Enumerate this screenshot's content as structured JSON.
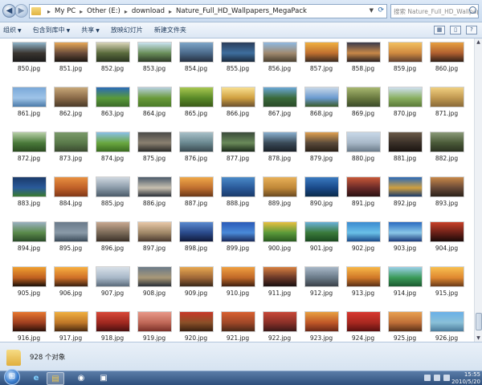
{
  "address_bar": {
    "crumbs": [
      "My PC",
      "Other (E:)",
      "download",
      "Nature_Full_HD_Wallpapers_MegaPack"
    ],
    "search_placeholder": "搜索 Nature_Full_HD_Wallpapers..."
  },
  "toolbar": {
    "organize": "组织",
    "include_in_library": "包含到库中",
    "share": "共享",
    "slideshow": "放映幻灯片",
    "new_folder": "新建文件夹"
  },
  "files": [
    {
      "name": "850.jpg",
      "colors": [
        "#8fb4c9",
        "#3a3530",
        "#1a1a1a"
      ]
    },
    {
      "name": "851.jpg",
      "colors": [
        "#e8a858",
        "#6a4c3a",
        "#1b1712"
      ]
    },
    {
      "name": "852.jpg",
      "colors": [
        "#d9d4b8",
        "#5a6b3c",
        "#2a3520"
      ]
    },
    {
      "name": "853.jpg",
      "colors": [
        "#c9e3f0",
        "#6a8f5a",
        "#2e3b28"
      ]
    },
    {
      "name": "854.jpg",
      "colors": [
        "#7ea6c9",
        "#4b6a8a",
        "#263040"
      ]
    },
    {
      "name": "855.jpg",
      "colors": [
        "#2a3d5a",
        "#3e6e9e",
        "#1a2a3c"
      ]
    },
    {
      "name": "856.jpg",
      "colors": [
        "#8fb8e0",
        "#a08a70",
        "#4a4030"
      ]
    },
    {
      "name": "857.jpg",
      "colors": [
        "#f0b040",
        "#c07030",
        "#3a2a20"
      ]
    },
    {
      "name": "858.jpg",
      "colors": [
        "#3a3a4a",
        "#c88848",
        "#2a2020"
      ]
    },
    {
      "name": "859.jpg",
      "colors": [
        "#f2c060",
        "#d08a40",
        "#604030"
      ]
    },
    {
      "name": "860.jpg",
      "colors": [
        "#e8a040",
        "#b06030",
        "#302018"
      ]
    },
    {
      "name": "861.jpg",
      "colors": [
        "#7aa8d8",
        "#9fc4e8",
        "#4a7aa8"
      ]
    },
    {
      "name": "862.jpg",
      "colors": [
        "#c8a878",
        "#8a6a48",
        "#4a3a28"
      ]
    },
    {
      "name": "863.jpg",
      "colors": [
        "#2a6ab8",
        "#5a9a3a",
        "#3a6a28"
      ]
    },
    {
      "name": "864.jpg",
      "colors": [
        "#b8d0e0",
        "#6a9a3a",
        "#4a7a28"
      ]
    },
    {
      "name": "865.jpg",
      "colors": [
        "#a8c850",
        "#5a8a28",
        "#3a5a18"
      ]
    },
    {
      "name": "866.jpg",
      "colors": [
        "#f8e090",
        "#d0a040",
        "#6a5030"
      ]
    },
    {
      "name": "867.jpg",
      "colors": [
        "#6aa8d8",
        "#3a6a3a",
        "#2a4a28"
      ]
    },
    {
      "name": "868.jpg",
      "colors": [
        "#c8d8e8",
        "#6a9ad0",
        "#3a5a2a"
      ]
    },
    {
      "name": "869.jpg",
      "colors": [
        "#a8b870",
        "#6a7a40",
        "#3a4a28"
      ]
    },
    {
      "name": "870.jpg",
      "colors": [
        "#d0e0f0",
        "#8ab060",
        "#5a7a38"
      ]
    },
    {
      "name": "871.jpg",
      "colors": [
        "#f0d080",
        "#c09850",
        "#8a6a38"
      ]
    },
    {
      "name": "872.jpg",
      "colors": [
        "#b8d0a8",
        "#4a7a3a",
        "#2a4a20"
      ]
    },
    {
      "name": "873.jpg",
      "colors": [
        "#7a9a6a",
        "#5a7a4a",
        "#3a4a30"
      ]
    },
    {
      "name": "874.jpg",
      "colors": [
        "#8ac0e8",
        "#6aa840",
        "#3a6a20"
      ]
    },
    {
      "name": "875.jpg",
      "colors": [
        "#4a4a48",
        "#8a8070",
        "#2a2a28"
      ]
    },
    {
      "name": "876.jpg",
      "colors": [
        "#a8c0c8",
        "#6a8890",
        "#3a4a50"
      ]
    },
    {
      "name": "877.jpg",
      "colors": [
        "#3a4a3a",
        "#6a8a5a",
        "#1a2a1a"
      ]
    },
    {
      "name": "878.jpg",
      "colors": [
        "#8ab0d0",
        "#3a4a58",
        "#1a2028"
      ]
    },
    {
      "name": "879.jpg",
      "colors": [
        "#e0a050",
        "#5a4a3a",
        "#2a2018"
      ]
    },
    {
      "name": "880.jpg",
      "colors": [
        "#c8d8e8",
        "#a8b8c8",
        "#6a7a88"
      ]
    },
    {
      "name": "881.jpg",
      "colors": [
        "#6a5a48",
        "#3a3028",
        "#1a1410"
      ]
    },
    {
      "name": "882.jpg",
      "colors": [
        "#8a9a78",
        "#4a5a38",
        "#2a3020"
      ]
    },
    {
      "name": "883.jpg",
      "colors": [
        "#1a3a6a",
        "#2a5a9a",
        "#3a7a30"
      ]
    },
    {
      "name": "884.jpg",
      "colors": [
        "#e89040",
        "#c06028",
        "#803818"
      ]
    },
    {
      "name": "885.jpg",
      "colors": [
        "#d0d8e0",
        "#8a9aa8",
        "#4a5a68"
      ]
    },
    {
      "name": "886.jpg",
      "colors": [
        "#4a5a6a",
        "#c8c0b0",
        "#2a3038"
      ]
    },
    {
      "name": "887.jpg",
      "colors": [
        "#f0a848",
        "#c07030",
        "#6a3818"
      ]
    },
    {
      "name": "888.jpg",
      "colors": [
        "#4a8ac8",
        "#2a5a9a",
        "#1a3a6a"
      ]
    },
    {
      "name": "889.jpg",
      "colors": [
        "#e8b058",
        "#c08838",
        "#6a4a20"
      ]
    },
    {
      "name": "890.jpg",
      "colors": [
        "#3a7ac0",
        "#1a4a8a",
        "#0a2a4a"
      ]
    },
    {
      "name": "891.jpg",
      "colors": [
        "#c85838",
        "#6a2a28",
        "#2a1010"
      ]
    },
    {
      "name": "892.jpg",
      "colors": [
        "#2a6ab8",
        "#d0a040",
        "#1a3a6a"
      ]
    },
    {
      "name": "893.jpg",
      "colors": [
        "#c88848",
        "#6a4a38",
        "#2a2018"
      ]
    },
    {
      "name": "894.jpg",
      "colors": [
        "#9ab0c0",
        "#5a8a4a",
        "#2a4a28"
      ]
    },
    {
      "name": "895.jpg",
      "colors": [
        "#6a7a8a",
        "#8a9aa8",
        "#3a4a58"
      ]
    },
    {
      "name": "896.jpg",
      "colors": [
        "#c8a890",
        "#7a6a58",
        "#3a3028"
      ]
    },
    {
      "name": "897.jpg",
      "colors": [
        "#e8c8a8",
        "#a08868",
        "#4a3a30"
      ]
    },
    {
      "name": "898.jpg",
      "colors": [
        "#5a8ad0",
        "#2a4a8a",
        "#101a3a"
      ]
    },
    {
      "name": "899.jpg",
      "colors": [
        "#2a5ab8",
        "#4a8ad8",
        "#1a2a5a"
      ]
    },
    {
      "name": "900.jpg",
      "colors": [
        "#e8c040",
        "#5a9a3a",
        "#2a5a20"
      ]
    },
    {
      "name": "901.jpg",
      "colors": [
        "#6ab0d8",
        "#3a7a3a",
        "#1a4a20"
      ]
    },
    {
      "name": "902.jpg",
      "colors": [
        "#3a8ad0",
        "#6ac0e8",
        "#1a4a8a"
      ]
    },
    {
      "name": "903.jpg",
      "colors": [
        "#2a6ac0",
        "#8ac8e8",
        "#1a3a7a"
      ]
    },
    {
      "name": "904.jpg",
      "colors": [
        "#c84028",
        "#6a2018",
        "#1a0a08"
      ]
    },
    {
      "name": "905.jpg",
      "colors": [
        "#f0a030",
        "#c06020",
        "#1a1008"
      ]
    },
    {
      "name": "906.jpg",
      "colors": [
        "#f8b040",
        "#d07028",
        "#3a2010"
      ]
    },
    {
      "name": "907.jpg",
      "colors": [
        "#d8e0e8",
        "#a8b8c8",
        "#5a6a7a"
      ]
    },
    {
      "name": "908.jpg",
      "colors": [
        "#6a7a88",
        "#a89878",
        "#2a3038"
      ]
    },
    {
      "name": "909.jpg",
      "colors": [
        "#e8a850",
        "#a06838",
        "#3a2818"
      ]
    },
    {
      "name": "910.jpg",
      "colors": [
        "#f0a040",
        "#c06828",
        "#402010"
      ]
    },
    {
      "name": "911.jpg",
      "colors": [
        "#d88040",
        "#6a3828",
        "#1a1010"
      ]
    },
    {
      "name": "912.jpg",
      "colors": [
        "#a8b8c8",
        "#6a7a88",
        "#3a4048"
      ]
    },
    {
      "name": "913.jpg",
      "colors": [
        "#f8b848",
        "#d07828",
        "#5a3018"
      ]
    },
    {
      "name": "914.jpg",
      "colors": [
        "#9ad0e8",
        "#3a9a58",
        "#1a5a30"
      ]
    },
    {
      "name": "915.jpg",
      "colors": [
        "#f8c050",
        "#e08830",
        "#6a3a18"
      ]
    },
    {
      "name": "916.jpg",
      "colors": [
        "#e87830",
        "#a04020",
        "#2a1008"
      ]
    },
    {
      "name": "917.jpg",
      "colors": [
        "#f0b040",
        "#c07828",
        "#4a2a10"
      ]
    },
    {
      "name": "918.jpg",
      "colors": [
        "#d84838",
        "#a02820",
        "#4a1010"
      ]
    },
    {
      "name": "919.jpg",
      "colors": [
        "#e89888",
        "#c06858",
        "#7a3028"
      ]
    },
    {
      "name": "920.jpg",
      "colors": [
        "#c83828",
        "#8a5028",
        "#3a2010"
      ]
    },
    {
      "name": "921.jpg",
      "colors": [
        "#d86030",
        "#a04828",
        "#4a2818"
      ]
    },
    {
      "name": "922.jpg",
      "colors": [
        "#c84838",
        "#8a3028",
        "#3a1818"
      ]
    },
    {
      "name": "923.jpg",
      "colors": [
        "#e8a040",
        "#c05828",
        "#6a2818"
      ]
    },
    {
      "name": "924.jpg",
      "colors": [
        "#d83830",
        "#a82820",
        "#5a1010"
      ]
    },
    {
      "name": "925.jpg",
      "colors": [
        "#e8a050",
        "#c07038",
        "#5a3018"
      ]
    },
    {
      "name": "926.jpg",
      "colors": [
        "#6ab0e8",
        "#8ac0d8",
        "#4a7a9a"
      ]
    }
  ],
  "status_bar": {
    "item_count": "928 个对象"
  },
  "taskbar": {
    "time": "15:55",
    "date": "2010/5/20"
  }
}
